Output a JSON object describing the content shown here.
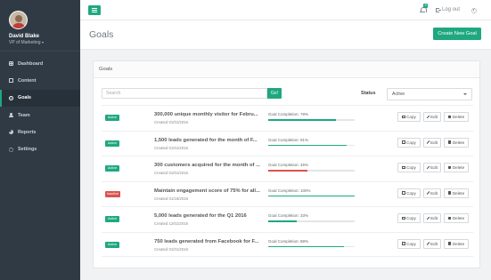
{
  "sidebar": {
    "user": {
      "name": "David Blake",
      "role": "VP of Marketing"
    },
    "items": [
      {
        "label": "Dashboard",
        "icon": "dashboard-icon",
        "active": false
      },
      {
        "label": "Content",
        "icon": "content-icon",
        "active": false
      },
      {
        "label": "Goals",
        "icon": "goals-icon",
        "active": true
      },
      {
        "label": "Team",
        "icon": "team-icon",
        "active": false
      },
      {
        "label": "Reports",
        "icon": "reports-icon",
        "active": false
      },
      {
        "label": "Settings",
        "icon": "settings-icon",
        "active": false
      }
    ]
  },
  "topbar": {
    "notification_count": "9",
    "logout_label": "Log out"
  },
  "header": {
    "title": "Goals",
    "create_label": "Create New Goal"
  },
  "panel": {
    "title": "Goals",
    "search_placeholder": "Search",
    "go_label": "Go!",
    "status_label": "Status",
    "status_value": "Active"
  },
  "goals": [
    {
      "status": "Active",
      "status_type": "active",
      "title": "300,000 unique monthly visitor for Febru...",
      "created": "Created 01/01/2016",
      "completion_text": "Goal Completion: 78%",
      "completion": 78,
      "copy": "Copy",
      "edit": "Edit",
      "delete": "Delete"
    },
    {
      "status": "Active",
      "status_type": "active",
      "title": "1,500 leads generated for the month of F...",
      "created": "Created 01/01/2016",
      "completion_text": "Goal Completion: 91%",
      "completion": 91,
      "copy": "Copy",
      "edit": "Edit",
      "delete": "Delete"
    },
    {
      "status": "Active",
      "status_type": "active",
      "title": "300 customers acquired for the month of ...",
      "created": "Created 01/01/2016",
      "completion_text": "Goal Completion: 45%",
      "completion": 45,
      "copy": "Copy",
      "edit": "Edit",
      "delete": "Delete"
    },
    {
      "status": "Inactive",
      "status_type": "inactive",
      "title": "Maintain engagement score of 75% for all...",
      "created": "Created 01/18/2016",
      "completion_text": "Goal Completion: 100%",
      "completion": 100,
      "copy": "Copy",
      "edit": "Edit",
      "delete": "Delete"
    },
    {
      "status": "Active",
      "status_type": "active",
      "title": "5,000 leads generated for the Q1 2016",
      "created": "Created 12/01/2016",
      "completion_text": "Goal Completion: 33%",
      "completion": 33,
      "copy": "Copy",
      "edit": "Edit",
      "delete": "Delete"
    },
    {
      "status": "Active",
      "status_type": "active",
      "title": "750 leads generated from Facebook for F...",
      "created": "Created 01/01/2016",
      "completion_text": "Goal Completion: 88%",
      "completion": 88,
      "copy": "Copy",
      "edit": "Edit",
      "delete": "Delete"
    }
  ],
  "colors": {
    "accent": "#1fa87f",
    "danger": "#d9534f",
    "sidebar": "#2f3a44"
  }
}
